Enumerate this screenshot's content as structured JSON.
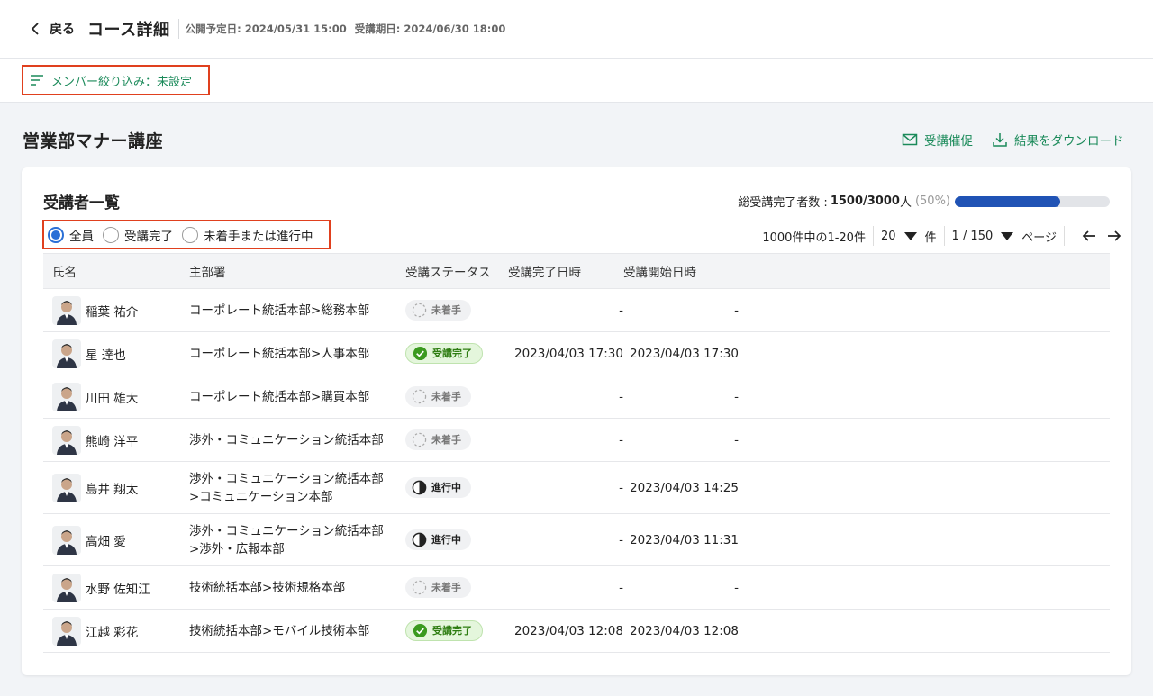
{
  "header": {
    "back_label": "戻る",
    "title": "コース詳細",
    "publish_date": "公開予定日: 2024/05/31 15:00",
    "deadline": "受講期日: 2024/06/30 18:00"
  },
  "member_filter": {
    "label": "メンバー絞り込み：未設定"
  },
  "course": {
    "name": "営業部マナー講座",
    "remind_label": "受講催促",
    "download_label": "結果をダウンロード"
  },
  "card": {
    "title": "受講者一覧",
    "completion_label": "総受講完了者数 :",
    "completion_count": "1500/3000",
    "completion_unit": "人",
    "completion_pct": "(50%)",
    "completion_fraction": 0.68,
    "status_filter": {
      "options": [
        "全員",
        "受講完了",
        "未着手または進行中"
      ],
      "selected": "全員"
    },
    "pager": {
      "summary": "1000件中の1-20件",
      "per_page": "20",
      "per_page_unit": "件",
      "page": "1 / 150",
      "page_unit": "ページ"
    }
  },
  "table": {
    "headers": [
      "氏名",
      "主部署",
      "受講ステータス",
      "受講完了日時",
      "受講開始日時"
    ],
    "rows": [
      {
        "name": "稲葉 祐介",
        "dept1": "コーポレート統括本部>総務本部",
        "dept2": "",
        "status": "未着手",
        "done": "-",
        "start": "-"
      },
      {
        "name": "星 達也",
        "dept1": "コーポレート統括本部>人事本部",
        "dept2": "",
        "status": "受講完了",
        "done": "2023/04/03 17:30",
        "start": "2023/04/03 17:30"
      },
      {
        "name": "川田 雄大",
        "dept1": "コーポレート統括本部>購買本部",
        "dept2": "",
        "status": "未着手",
        "done": "-",
        "start": "-"
      },
      {
        "name": "熊崎 洋平",
        "dept1": "渉外・コミュニケーション統括本部",
        "dept2": "",
        "status": "未着手",
        "done": "-",
        "start": "-"
      },
      {
        "name": "島井 翔太",
        "dept1": "渉外・コミュニケーション統括本部",
        "dept2": ">コミュニケーション本部",
        "status": "進行中",
        "done": "-",
        "start": "2023/04/03 14:25"
      },
      {
        "name": "高畑 愛",
        "dept1": "渉外・コミュニケーション統括本部",
        "dept2": ">渉外・広報本部",
        "status": "進行中",
        "done": "-",
        "start": "2023/04/03 11:31"
      },
      {
        "name": "水野 佐知江",
        "dept1": "技術統括本部>技術規格本部",
        "dept2": "",
        "status": "未着手",
        "done": "-",
        "start": "-"
      },
      {
        "name": "江越 彩花",
        "dept1": "技術統括本部>モバイル技術本部",
        "dept2": "",
        "status": "受講完了",
        "done": "2023/04/03 12:08",
        "start": "2023/04/03 12:08"
      }
    ]
  },
  "colors": {
    "accent_green": "#1b8a5a",
    "highlight_red": "#e0401e",
    "progress_blue": "#2053b5",
    "radio_blue": "#2a6fd6"
  }
}
